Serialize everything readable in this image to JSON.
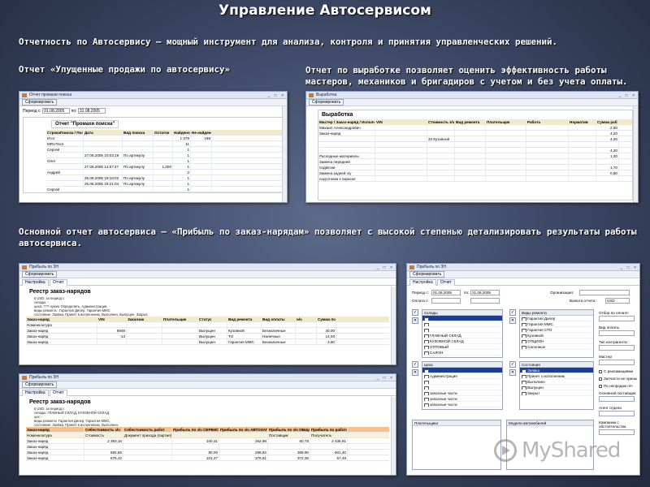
{
  "page": {
    "title": "Управление Автосервисом",
    "intro": "Отчетность по Автосервису – мощный инструмент для анализа, контроля и принятия управленческих решений.",
    "caption_left": "Отчет «Упущенные продажи по автосервису»",
    "caption_right": "Отчет по выработке позволяет оценить эффективность работы мастеров, механиков и бригадиров с учетом и без учета оплаты.",
    "caption_main": "Основной отчет автосервиса – «Прибыль по заказ-нарядам» позволяет с высокой степенью детализировать результаты работы автосервиса."
  },
  "win_promah": {
    "title": "Отчет промахи поиска",
    "generate_btn": "Сформировать",
    "period_label": "Период с:",
    "date_from": "01.08.2005",
    "to_label": "по:",
    "date_to": "31.08.2005",
    "report_name": "Отчет \"Промахи поиска\"",
    "columns": [
      "СтрокаПоиска / Пользователь",
      "Дата",
      "Вид поиска",
      "Остаток",
      "Найдено",
      "Не найдено"
    ],
    "rows": [
      [
        "Итог",
        "",
        "",
        "",
        "1 379",
        "198"
      ],
      [
        "MR17613",
        "",
        "",
        "",
        "11",
        ""
      ],
      [
        "Сергей",
        "",
        "",
        "",
        "1",
        ""
      ],
      [
        "",
        "27.08.2005 10:03:19",
        "По артикулу",
        "",
        "1",
        ""
      ],
      [
        "Олег",
        "",
        "",
        "",
        "1",
        ""
      ],
      [
        "",
        "27.08.2005 14:57:47",
        "По артикулу",
        "1,000",
        "1",
        ""
      ],
      [
        "Андрей",
        "",
        "",
        "",
        "2",
        ""
      ],
      [
        "",
        "25.08.2005 19:18:02",
        "По артикулу",
        "",
        "1",
        ""
      ],
      [
        "",
        "25.08.2005 19:21:04",
        "По артикулу",
        "",
        "1",
        ""
      ],
      [
        "Сергей",
        "",
        "",
        "",
        "1",
        ""
      ]
    ]
  },
  "win_vyrab": {
    "title": "Выработка",
    "generate_btn": "Сформировать",
    "report_name": "Выработка",
    "columns": [
      "Мастер / Заказ-наряд / Исполнитель",
      "VIN",
      "Стоимость з/ч",
      "Вид ремонта",
      "Плательщик",
      "Работа",
      "Норматив",
      "Сумма раб"
    ],
    "rows": [
      [
        "Михаил Александрович",
        "",
        "",
        "",
        "",
        "",
        "",
        "2,50"
      ],
      [
        "Заказ-наряд",
        "",
        "",
        "",
        "",
        "",
        "",
        "4,20"
      ],
      [
        "",
        "",
        "34 Кузовной",
        "",
        "",
        "",
        "",
        "4,20"
      ],
      [
        "",
        "",
        "",
        "",
        "",
        "",
        "",
        ""
      ],
      [
        "",
        "",
        "",
        "",
        "",
        "",
        "",
        "4,20"
      ],
      [
        "Расходные материалы",
        "",
        "",
        "",
        "",
        "",
        "",
        "1,20"
      ],
      [
        "Замена передней",
        "",
        "",
        "",
        "",
        "",
        "",
        ""
      ],
      [
        "подвески",
        "",
        "",
        "",
        "",
        "",
        "",
        "1,70"
      ],
      [
        "Замена задней з/у",
        "",
        "",
        "",
        "",
        "",
        "",
        "0,80"
      ],
      [
        "подготовка к окраске",
        "",
        "",
        "",
        "",
        "",
        "",
        ""
      ]
    ]
  },
  "win_zn1": {
    "title": "Прибыль по ЗН",
    "generate_btn": "Сформировать",
    "tabs": [
      "Настройка",
      "Отчет"
    ],
    "doc_title": "Реестр заказ-нарядов",
    "meta": [
      "в USD, за период с",
      "склады: -",
      "цеха: ??? нужно Определить, Администрация,",
      "виды ремонта : Гарантия Дилер, Гарантия ММС",
      "состояние: Заявка, Принят в исполнению, Выполнен, Выпущен, Закрыт,"
    ],
    "columns": [
      "Заказ-наряд",
      "VIN",
      "Заказчик",
      "Плательщик",
      "Статус",
      "Вид ремонта",
      "Вид оплаты",
      "н/ч",
      "Сумма по"
    ],
    "rows": [
      [
        "Номенклатура",
        "",
        "",
        "",
        "",
        "",
        "",
        "",
        ""
      ],
      [
        "Заказ-наряд",
        "6949",
        "",
        "",
        "Выпущен",
        "Кузовной",
        "Безналичные",
        "",
        "40,00"
      ],
      [
        "Заказ-наряд",
        "-13",
        "",
        "",
        "Выпущен",
        "ТО",
        "Наличные",
        "",
        "14,00"
      ],
      [
        "Заказ-наряд",
        "",
        "",
        "",
        "Выпущен",
        "Гарантия ММС",
        "Безналичные",
        "",
        "3,60"
      ]
    ]
  },
  "win_zn2": {
    "title": "Прибыль по ЗН",
    "generate_btn": "Сформировать",
    "tabs": [
      "Настройка",
      "Отчет"
    ],
    "doc_title": "Реестр заказ-нарядов",
    "meta": [
      "в USD, за период с",
      "склады: ГЛАВНЫЙ СКЛАД, КУЗОВНОЙ СКЛАД",
      "цех: -",
      "виды ремонта: Гарантия Дилер, Гарантия ММС,",
      "состояние: Заявка, Принят в исполнению, Выполнен,"
    ],
    "columns": [
      "Заказ-наряд",
      "Себестоимость з/ч",
      "Себестоимость работ",
      "Прибыль по з/ч СЕРВИС",
      "Прибыль по з/ч АВТОЗАПЧАСТИ",
      "Прибыль по з/ч ОБЩАЯ",
      "Прибыль по работам"
    ],
    "subheader": [
      "Номенклатура",
      "Стоимость",
      "Документ прихода (партия)",
      "",
      "",
      "Поставщик",
      "Получатель"
    ],
    "rows": [
      [
        "Заказ-наряд",
        "2 363,16",
        "",
        "340,31",
        "262,98",
        "60,78",
        "2 436,91"
      ],
      [
        "Заказ-наряд",
        "",
        "",
        "",
        "",
        "",
        ""
      ],
      [
        "Заказ-наряд",
        "592,55",
        "",
        "80,00",
        "298,92",
        "369,90",
        "601,40"
      ],
      [
        "Заказ-наряд",
        "675,42",
        "",
        "101,27",
        "376,61",
        "372,38",
        "57,48"
      ]
    ]
  },
  "win_settings": {
    "title": "Прибыль по ЗН",
    "generate_btn": "Сформировать",
    "tabs": [
      "Настройка",
      "Отчет"
    ],
    "period_label": "Период с:",
    "date_from": "01.08.2005",
    "to_label": "по:",
    "date_to": "31.08.2005",
    "org_label": "Организация:",
    "paid_label": "Оплата с:",
    "currency_label": "Валюта отчета:",
    "currency": "USD",
    "sklady_header": "Склады",
    "sklady": [
      "",
      "",
      "",
      "ГЛАВНЫЙ СКЛАД",
      "КУЗОВНОЙ СКЛАД",
      "ОПТОВЫЙ",
      "САЛОН"
    ],
    "vidy_header": "Виды ремонта",
    "vidy": [
      "Гарантия Дилер",
      "Гарантия ММС",
      "Гарантия СТО",
      "Кузовной",
      "ОПЦИОН",
      "Салонные"
    ],
    "ceh_header": "Цеха",
    "ceh": [
      "",
      "Администрация",
      "",
      "",
      "запасные части",
      "запасные части",
      "запасные части"
    ],
    "state_header": "Состояния",
    "states": [
      "Заявка",
      "Принят к исполнению",
      "Выполнен",
      "Выпущен",
      "Закрыт"
    ],
    "payers_header": "Плательщики",
    "models_header": "Модели автомобилей",
    "right_labels": [
      "Отбор по оплате:",
      "Вид оплаты",
      "Тип контрагента:",
      "Мастер",
      "С рекламациями",
      "Запчасти не нужны",
      "По непродаж н/ч",
      "Основной поставщик:",
      "Агент отдела",
      "Компании с обстоятельства"
    ]
  },
  "watermark": {
    "text": "MyShared"
  }
}
